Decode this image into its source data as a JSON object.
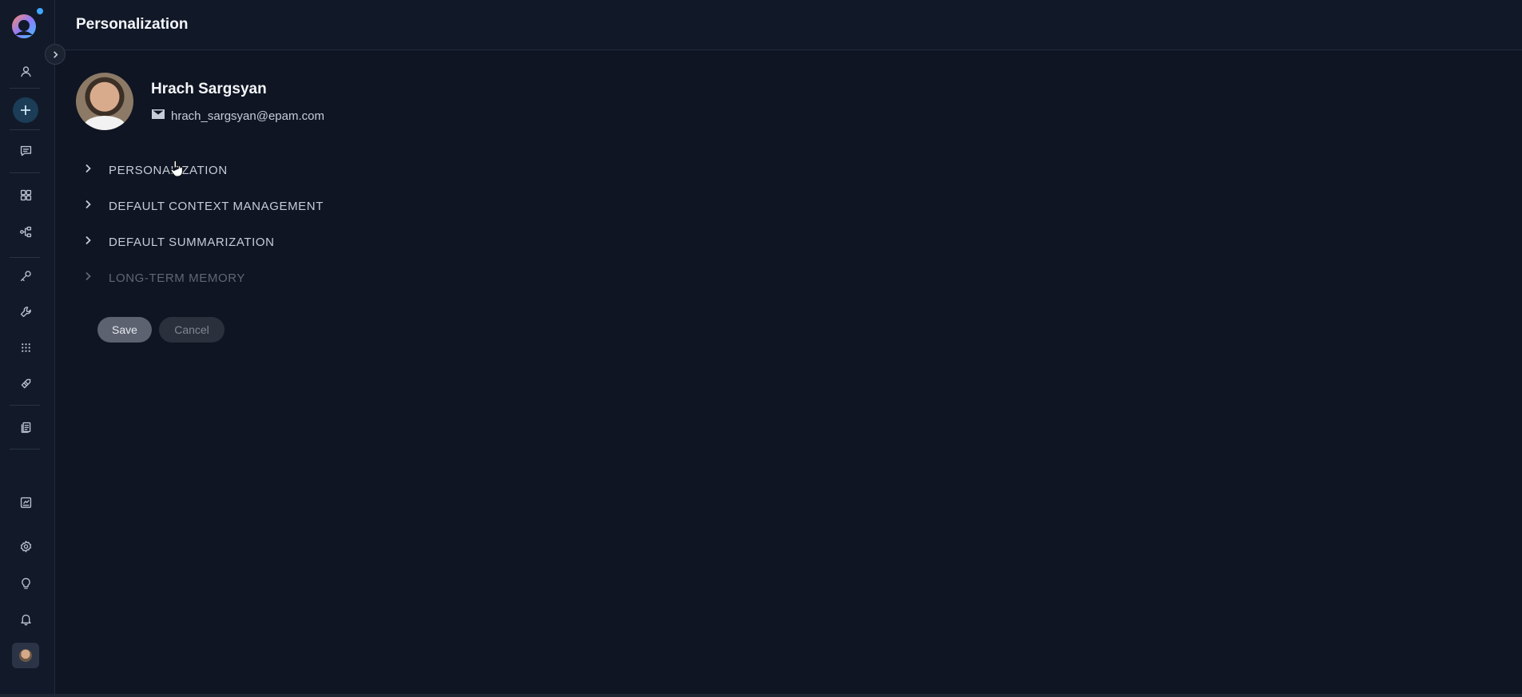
{
  "app": {
    "brand_icon": "app-logo",
    "colors": {
      "background": "#0f1522",
      "sidebar": "#121a29",
      "accent": "#1b3d57",
      "notification_dot": "#3fa7ff"
    }
  },
  "header": {
    "title": "Personalization"
  },
  "sidebar": {
    "items": [
      {
        "name": "user-icon"
      },
      {
        "name": "add-icon"
      },
      {
        "name": "chat-icon"
      },
      {
        "name": "dashboard-icon"
      },
      {
        "name": "workflow-icon"
      },
      {
        "name": "key-icon"
      },
      {
        "name": "wrench-icon"
      },
      {
        "name": "apps-grid-icon"
      },
      {
        "name": "tag-icon"
      },
      {
        "name": "documents-icon"
      },
      {
        "name": "report-icon"
      },
      {
        "name": "settings-icon"
      },
      {
        "name": "lightbulb-icon"
      },
      {
        "name": "bell-icon"
      }
    ]
  },
  "profile": {
    "name": "Hrach Sargsyan",
    "email": "hrach_sargsyan@epam.com"
  },
  "sections": [
    {
      "label": "PERSONALIZATION",
      "enabled": true
    },
    {
      "label": "DEFAULT CONTEXT MANAGEMENT",
      "enabled": true
    },
    {
      "label": "DEFAULT SUMMARIZATION",
      "enabled": true
    },
    {
      "label": "LONG-TERM MEMORY",
      "enabled": false
    }
  ],
  "actions": {
    "save": "Save",
    "cancel": "Cancel"
  }
}
